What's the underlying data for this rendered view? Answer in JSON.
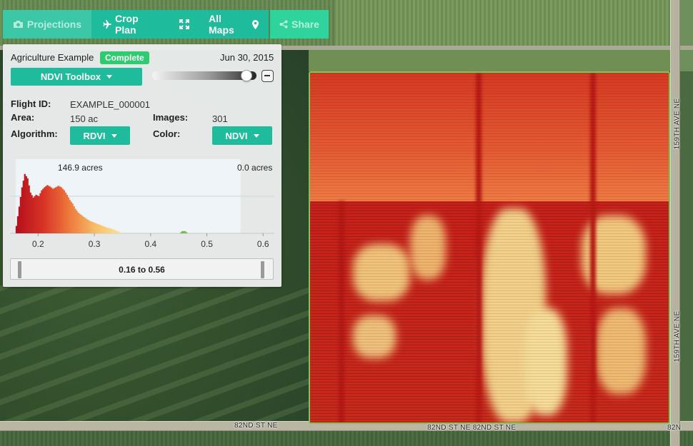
{
  "toolbar": {
    "projections": "Projections",
    "crop_plan": "Crop Plan",
    "all_maps": "All Maps",
    "share": "Share"
  },
  "panel": {
    "project_name": "Agriculture Example",
    "status_badge": "Complete",
    "date": "Jun 30, 2015",
    "toolbox_label": "NDVI Toolbox",
    "opacity_level": 0.95,
    "flight_id_label": "Flight ID:",
    "flight_id_value": "EXAMPLE_000001",
    "area_label": "Area:",
    "area_value": "150 ac",
    "images_label": "Images:",
    "images_value": "301",
    "algorithm_label": "Algorithm:",
    "algorithm_value": "RDVI",
    "color_label": "Color:",
    "color_value": "NDVI",
    "range_label": "0.16 to 0.56"
  },
  "chart_data": {
    "type": "area",
    "selected_acres_label": "146.9 acres",
    "outside_acres_label": "0.0 acres",
    "xlim": [
      0.15,
      0.62
    ],
    "selected_range": [
      0.16,
      0.56
    ],
    "xticks": [
      "0.2",
      "0.3",
      "0.4",
      "0.5",
      "0.6"
    ],
    "xtick_values": [
      0.2,
      0.3,
      0.4,
      0.5,
      0.6
    ],
    "x": [
      0.16,
      0.17,
      0.175,
      0.18,
      0.185,
      0.19,
      0.195,
      0.2,
      0.205,
      0.21,
      0.215,
      0.22,
      0.225,
      0.23,
      0.235,
      0.24,
      0.245,
      0.25,
      0.255,
      0.26,
      0.265,
      0.27,
      0.28,
      0.29,
      0.3,
      0.31,
      0.32,
      0.33,
      0.34,
      0.35,
      0.45,
      0.455,
      0.46,
      0.465
    ],
    "y": [
      0.1,
      0.62,
      0.8,
      0.74,
      0.55,
      0.48,
      0.52,
      0.5,
      0.58,
      0.62,
      0.65,
      0.63,
      0.6,
      0.62,
      0.64,
      0.62,
      0.58,
      0.52,
      0.45,
      0.4,
      0.33,
      0.28,
      0.22,
      0.17,
      0.14,
      0.11,
      0.08,
      0.06,
      0.03,
      0.0,
      0.0,
      0.03,
      0.03,
      0.0
    ]
  }
}
